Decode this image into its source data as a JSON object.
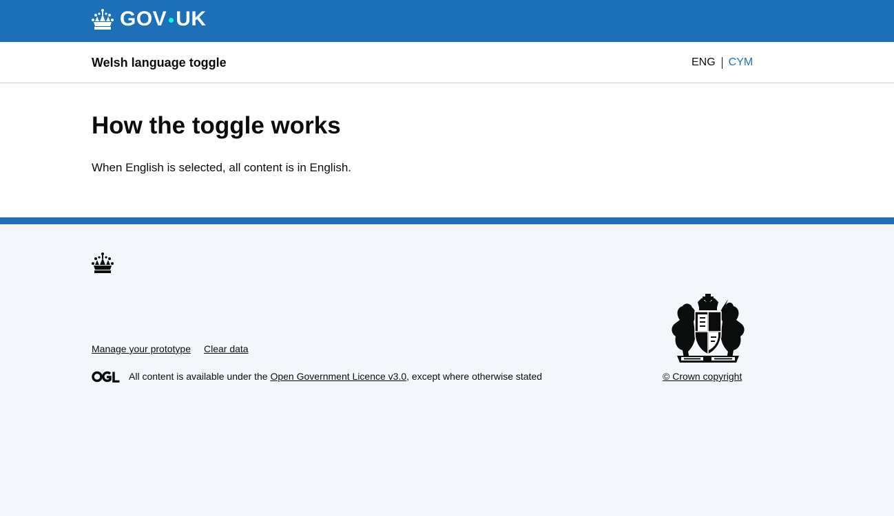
{
  "header": {
    "logo_left": "GOV",
    "logo_right": "UK"
  },
  "service_nav": {
    "service_name": "Welsh language toggle",
    "lang_current": "ENG",
    "lang_other": "CYM"
  },
  "main": {
    "heading": "How the toggle works",
    "paragraph": "When English is selected, all content is in English."
  },
  "footer": {
    "links": [
      "Manage your prototype",
      "Clear data"
    ],
    "licence_prefix": "All content is available under the ",
    "licence_link": "Open Government Licence v3.0",
    "licence_suffix": ", except where otherwise stated",
    "copyright": "© Crown copyright"
  },
  "colors": {
    "brand_blue": "#1d70b8",
    "logo_dot": "#00ffe0",
    "footer_bg": "#f3f7fb",
    "text": "#0b0c0c"
  },
  "icons": [
    "crown-icon",
    "ogl-logo-icon",
    "royal-coat-of-arms-icon"
  ]
}
